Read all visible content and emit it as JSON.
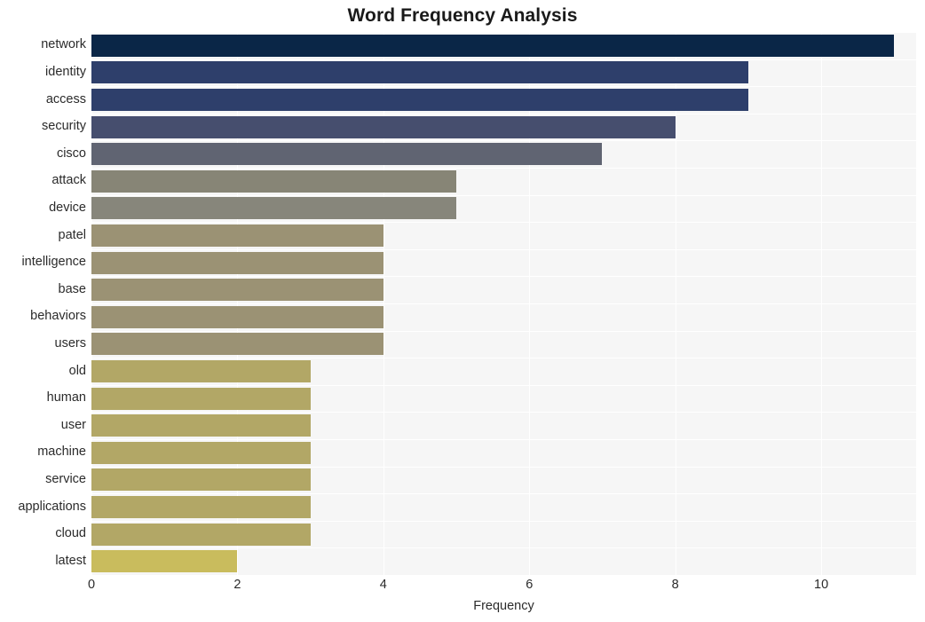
{
  "chart_data": {
    "type": "bar",
    "orientation": "horizontal",
    "title": "Word Frequency Analysis",
    "xlabel": "Frequency",
    "ylabel": "",
    "categories": [
      "network",
      "identity",
      "access",
      "security",
      "cisco",
      "attack",
      "device",
      "patel",
      "intelligence",
      "base",
      "behaviors",
      "users",
      "old",
      "human",
      "user",
      "machine",
      "service",
      "applications",
      "cloud",
      "latest"
    ],
    "values": [
      11,
      9,
      9,
      8,
      7,
      5,
      5,
      4,
      4,
      4,
      4,
      4,
      3,
      3,
      3,
      3,
      3,
      3,
      3,
      2
    ],
    "xlim": [
      0,
      11.3
    ],
    "xticks": [
      0,
      2,
      4,
      6,
      8,
      10
    ],
    "xticklabels": [
      "0",
      "2",
      "4",
      "6",
      "8",
      "10"
    ],
    "grid": true,
    "legend": false,
    "colormap": "cividis",
    "bar_colors": [
      "#0a2647",
      "#2e3f6b",
      "#2e3f6b",
      "#464e6e",
      "#606472",
      "#878576",
      "#87867b",
      "#9b9274",
      "#9b9274",
      "#9b9274",
      "#9b9274",
      "#9b9274",
      "#b2a766",
      "#b2a766",
      "#b2a766",
      "#b2a766",
      "#b2a766",
      "#b2a766",
      "#b2a766",
      "#c9bc5d"
    ]
  },
  "style": {
    "plot_background": "#f6f6f6",
    "gridline_color": "#ffffff",
    "figure_background": "#ffffff",
    "text_color": "#2b2b2b",
    "title_color": "#1a1a1a"
  }
}
